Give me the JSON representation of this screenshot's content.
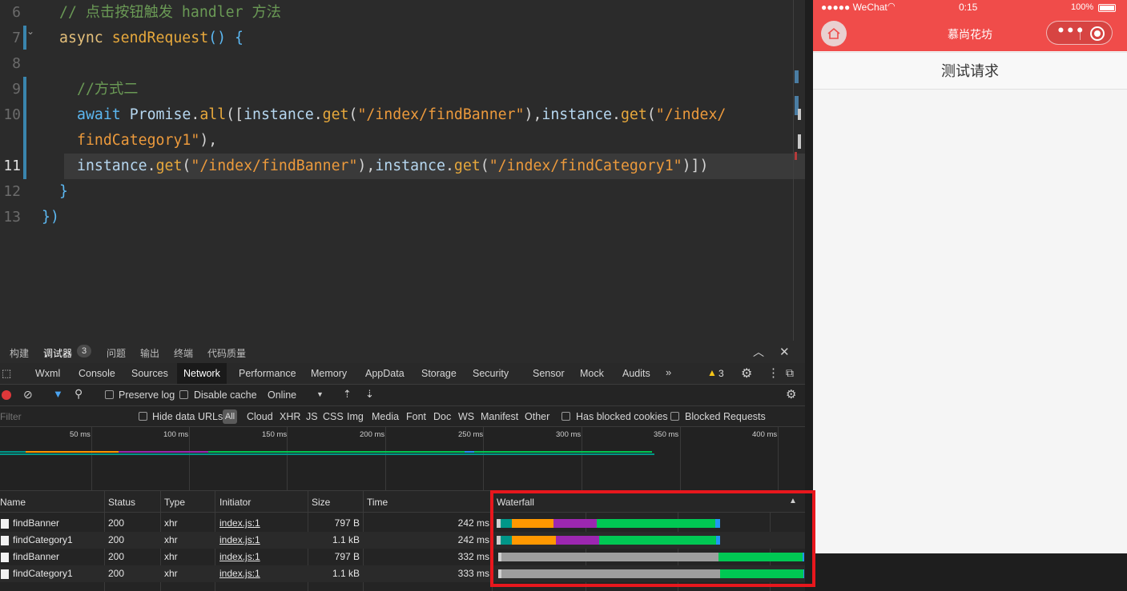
{
  "editor": {
    "lines": [
      {
        "num": "6",
        "tokens": [
          {
            "t": "// 点击按钮触发 handler 方法",
            "c": "t-com"
          }
        ],
        "indent": 74
      },
      {
        "num": "7",
        "tokens": [
          {
            "t": "async",
            "c": "t-kw"
          },
          {
            "t": " ",
            "c": "t-br"
          },
          {
            "t": "sendRequest",
            "c": "t-fn"
          },
          {
            "t": "() {",
            "c": "t-kw2"
          }
        ],
        "indent": 74
      },
      {
        "num": "8",
        "tokens": [],
        "indent": 74
      },
      {
        "num": "9",
        "tokens": [
          {
            "t": "//方式二",
            "c": "t-com"
          }
        ],
        "indent": 96
      },
      {
        "num": "10",
        "tokens": [
          {
            "t": "await",
            "c": "t-kw2"
          },
          {
            "t": " ",
            "c": "t-br"
          },
          {
            "t": "Promise",
            "c": "t-obj"
          },
          {
            "t": ".",
            "c": "t-br"
          },
          {
            "t": "all",
            "c": "t-fn"
          },
          {
            "t": "([",
            "c": "t-br"
          },
          {
            "t": "instance",
            "c": "t-obj"
          },
          {
            "t": ".",
            "c": "t-br"
          },
          {
            "t": "get",
            "c": "t-fn"
          },
          {
            "t": "(",
            "c": "t-br"
          },
          {
            "t": "\"/index/findBanner\"",
            "c": "t-str"
          },
          {
            "t": "),",
            "c": "t-br"
          },
          {
            "t": "instance",
            "c": "t-obj"
          },
          {
            "t": ".",
            "c": "t-br"
          },
          {
            "t": "get",
            "c": "t-fn"
          },
          {
            "t": "(",
            "c": "t-br"
          },
          {
            "t": "\"/index/",
            "c": "t-str"
          }
        ],
        "indent": 96
      },
      {
        "num": "",
        "tokens": [
          {
            "t": "findCategory1\"",
            "c": "t-str"
          },
          {
            "t": "),",
            "c": "t-br"
          }
        ],
        "indent": 96
      },
      {
        "num": "11",
        "tokens": [
          {
            "t": "instance",
            "c": "t-obj"
          },
          {
            "t": ".",
            "c": "t-br"
          },
          {
            "t": "get",
            "c": "t-fn"
          },
          {
            "t": "(",
            "c": "t-br"
          },
          {
            "t": "\"/index/findBanner\"",
            "c": "t-str"
          },
          {
            "t": "),",
            "c": "t-br"
          },
          {
            "t": "instance",
            "c": "t-obj"
          },
          {
            "t": ".",
            "c": "t-br"
          },
          {
            "t": "get",
            "c": "t-fn"
          },
          {
            "t": "(",
            "c": "t-br"
          },
          {
            "t": "\"/index/findCategory1\"",
            "c": "t-str"
          },
          {
            "t": ")])",
            "c": "t-br"
          }
        ],
        "indent": 96,
        "active": true
      },
      {
        "num": "12",
        "tokens": [
          {
            "t": "}",
            "c": "t-kw2"
          }
        ],
        "indent": 74
      },
      {
        "num": "13",
        "tokens": [
          {
            "t": "})",
            "c": "t-kw2"
          }
        ],
        "indent": 52
      }
    ]
  },
  "phone": {
    "status": {
      "carrier": "●●●●● WeChat",
      "time": "0:15",
      "battery": "100%"
    },
    "nav_title": "慕尚花坊",
    "test_button": "测试请求"
  },
  "devtools": {
    "panel_tabs": [
      "构建",
      "调试器",
      "问题",
      "输出",
      "终端",
      "代码质量"
    ],
    "debugger_badge": "3",
    "tabs": [
      "Wxml",
      "Console",
      "Sources",
      "Network",
      "Performance",
      "Memory",
      "AppData",
      "Storage",
      "Security",
      "Sensor",
      "Mock",
      "Audits"
    ],
    "active_tab": "Network",
    "warning_count": "3",
    "toolbar": {
      "preserve_log": "Preserve log",
      "disable_cache": "Disable cache",
      "throttle": "Online"
    },
    "filter": {
      "placeholder": "Filter",
      "hide_data_urls": "Hide data URLs",
      "all": "All",
      "types": [
        "Cloud",
        "XHR",
        "JS",
        "CSS",
        "Img",
        "Media",
        "Font",
        "Doc",
        "WS",
        "Manifest",
        "Other"
      ],
      "has_blocked_cookies": "Has blocked cookies",
      "blocked_requests": "Blocked Requests"
    },
    "overview_ticks": [
      "50 ms",
      "100 ms",
      "150 ms",
      "200 ms",
      "250 ms",
      "300 ms",
      "350 ms",
      "400 ms"
    ],
    "columns": [
      "Name",
      "Status",
      "Type",
      "Initiator",
      "Size",
      "Time",
      "Waterfall"
    ],
    "requests": [
      {
        "name": "findBanner",
        "status": "200",
        "type": "xhr",
        "initiator": "index.js:1",
        "size": "797 B",
        "time": "242 ms"
      },
      {
        "name": "findCategory1",
        "status": "200",
        "type": "xhr",
        "initiator": "index.js:1",
        "size": "1.1 kB",
        "time": "242 ms"
      },
      {
        "name": "findBanner",
        "status": "200",
        "type": "xhr",
        "initiator": "index.js:1",
        "size": "797 B",
        "time": "332 ms"
      },
      {
        "name": "findCategory1",
        "status": "200",
        "type": "xhr",
        "initiator": "index.js:1",
        "size": "1.1 kB",
        "time": "333 ms"
      }
    ]
  },
  "colors": {
    "accent_red": "#f04c4a",
    "highlight_red": "#e8171d",
    "waterfall_green": "#00c853",
    "waterfall_orange": "#ff9800",
    "waterfall_purple": "#9c27b0",
    "waterfall_teal": "#009688",
    "waterfall_gray": "#9e9e9e",
    "waterfall_blue": "#2196f3"
  }
}
